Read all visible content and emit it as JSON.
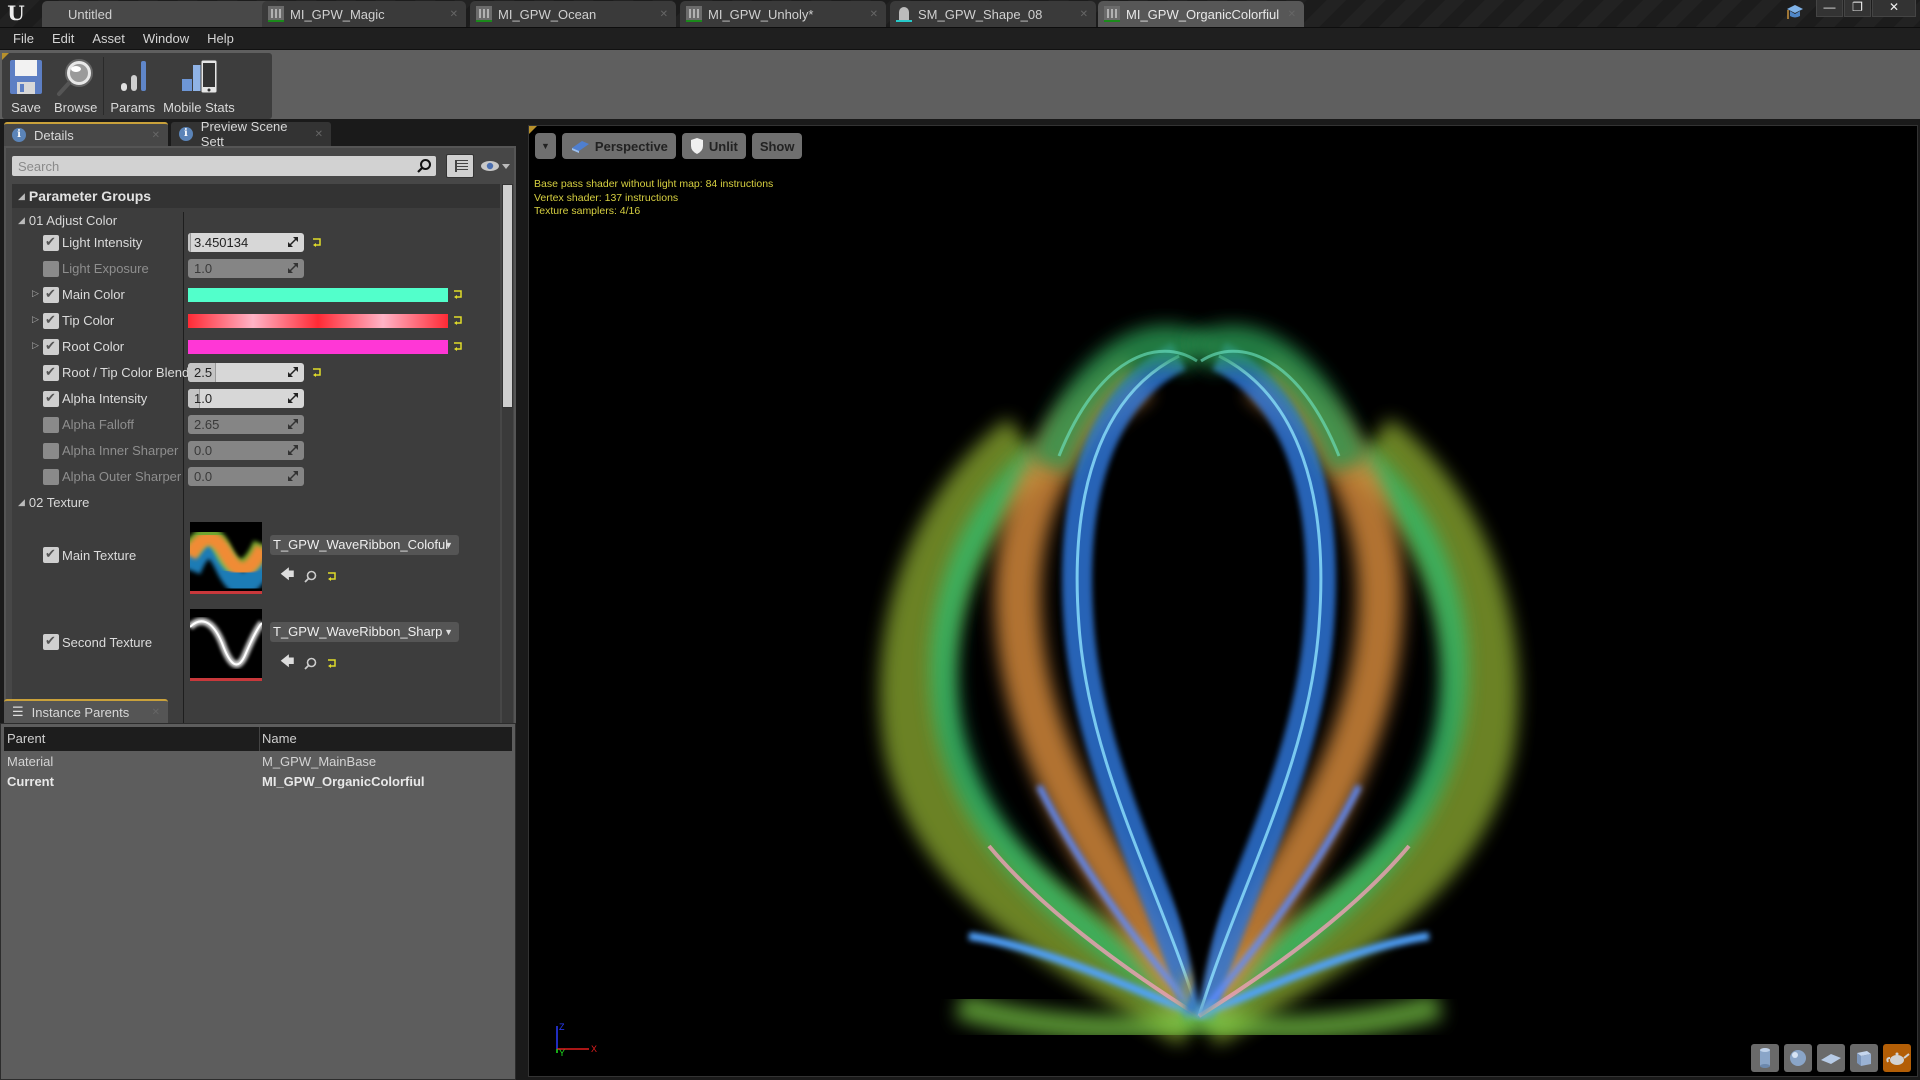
{
  "app": {
    "logo": "U",
    "tabs": [
      {
        "label": "Untitled",
        "icon": "unreal-logo",
        "kind": "untitled"
      },
      {
        "label": "MI_GPW_Magic",
        "icon": "material-instance-icon",
        "kind": "material"
      },
      {
        "label": "MI_GPW_Ocean",
        "icon": "material-instance-icon",
        "kind": "material"
      },
      {
        "label": "MI_GPW_Unholy*",
        "icon": "material-instance-icon",
        "kind": "material"
      },
      {
        "label": "SM_GPW_Shape_08",
        "icon": "static-mesh-icon",
        "kind": "mesh"
      },
      {
        "label": "MI_GPW_OrganicColorfiul",
        "icon": "material-instance-icon",
        "kind": "material",
        "active": true
      }
    ],
    "window_controls": {
      "minimize": "—",
      "restore": "❐",
      "close": "✕"
    }
  },
  "menu": [
    "File",
    "Edit",
    "Asset",
    "Window",
    "Help"
  ],
  "toolbar": {
    "save": "Save",
    "browse": "Browse",
    "params": "Params",
    "mobile_stats": "Mobile Stats"
  },
  "details": {
    "tab_label": "Details",
    "preview_tab_label": "Preview Scene Sett",
    "search_placeholder": "Search",
    "parameter_groups_label": "Parameter Groups",
    "groups": [
      {
        "label": "01 Adjust Color",
        "params": [
          {
            "label": "Light Intensity",
            "type": "scalar",
            "value": "3.450134",
            "checked": true,
            "enabled": true,
            "slider_fraction": 0.02,
            "reset": true
          },
          {
            "label": "Light Exposure",
            "type": "scalar",
            "value": "1.0",
            "checked": false,
            "enabled": false,
            "reset": false
          },
          {
            "label": "Main Color",
            "type": "color",
            "color": "#52ffcb",
            "checked": true,
            "enabled": true,
            "expandable": true,
            "reset": true
          },
          {
            "label": "Tip Color",
            "type": "color",
            "color": "#ff2a35",
            "color_highlight": "#ffb3c6",
            "checked": true,
            "enabled": true,
            "expandable": true,
            "reset": true
          },
          {
            "label": "Root Color",
            "type": "color",
            "color": "#ff37d6",
            "checked": true,
            "enabled": true,
            "expandable": true,
            "reset": true
          },
          {
            "label": "Root / Tip Color Blend",
            "type": "scalar",
            "value": "2.5",
            "checked": true,
            "enabled": true,
            "slider_fraction": 0.25,
            "reset": true
          },
          {
            "label": "Alpha Intensity",
            "type": "scalar",
            "value": "1.0",
            "checked": true,
            "enabled": true,
            "slider_fraction": 0.1,
            "reset": false
          },
          {
            "label": "Alpha Falloff",
            "type": "scalar",
            "value": "2.65",
            "checked": false,
            "enabled": false,
            "reset": false
          },
          {
            "label": "Alpha Inner Sharper",
            "type": "scalar",
            "value": "0.0",
            "checked": false,
            "enabled": false,
            "reset": false
          },
          {
            "label": "Alpha Outer Sharper",
            "type": "scalar",
            "value": "0.0",
            "checked": false,
            "enabled": false,
            "reset": false
          }
        ]
      },
      {
        "label": "02 Texture",
        "params": [
          {
            "label": "Main Texture",
            "type": "texture",
            "value": "T_GPW_WaveRibbon_Coloful",
            "checked": true
          },
          {
            "label": "Second Texture",
            "type": "texture",
            "value": "T_GPW_WaveRibbon_Sharp",
            "checked": true
          }
        ]
      }
    ]
  },
  "instance_parents": {
    "tab_label": "Instance Parents",
    "columns": [
      "Parent",
      "Name"
    ],
    "rows": [
      {
        "parent": "Material",
        "name": "M_GPW_MainBase",
        "bold": false
      },
      {
        "parent": "Current",
        "name": "MI_GPW_OrganicColorfiul",
        "bold": true
      }
    ]
  },
  "viewport": {
    "view_mode": "Perspective",
    "lighting_mode": "Unlit",
    "show_label": "Show",
    "stats": [
      "Base pass shader without light map: 84 instructions",
      "Vertex shader: 137 instructions",
      "Texture samplers: 4/16"
    ],
    "axis_labels": {
      "x": "X",
      "y": "Y",
      "z": "Z"
    },
    "preview_shapes": [
      "cylinder",
      "sphere",
      "plane",
      "cube",
      "teapot"
    ],
    "active_preview_shape": "teapot",
    "stats_color": "#d6cf40"
  }
}
